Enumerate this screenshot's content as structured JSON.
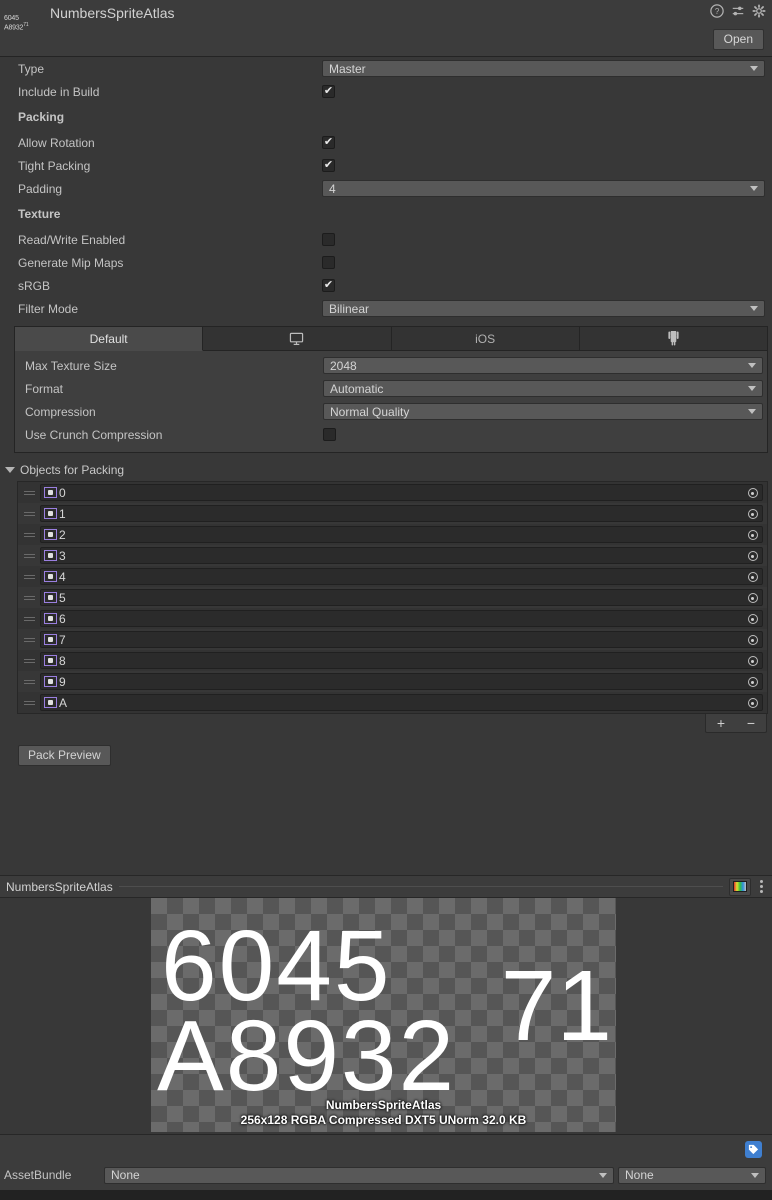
{
  "header": {
    "title": "NumbersSpriteAtlas",
    "thumb_line1": "6045",
    "thumb_line2": "A8932",
    "thumb_sup": "71",
    "open_label": "Open",
    "icons": [
      {
        "name": "help-icon",
        "glyph": "?"
      },
      {
        "name": "preset-icon",
        "glyph": ""
      },
      {
        "name": "gear-icon",
        "glyph": ""
      }
    ]
  },
  "properties": {
    "type": {
      "label": "Type",
      "value": "Master"
    },
    "include_in_build": {
      "label": "Include in Build",
      "checked": true
    }
  },
  "packing": {
    "section_label": "Packing",
    "allow_rotation": {
      "label": "Allow Rotation",
      "checked": true
    },
    "tight_packing": {
      "label": "Tight Packing",
      "checked": true
    },
    "padding": {
      "label": "Padding",
      "value": "4"
    }
  },
  "texture": {
    "section_label": "Texture",
    "read_write": {
      "label": "Read/Write Enabled",
      "checked": false
    },
    "mip_maps": {
      "label": "Generate Mip Maps",
      "checked": false
    },
    "srgb": {
      "label": "sRGB",
      "checked": true
    },
    "filter_mode": {
      "label": "Filter Mode",
      "value": "Bilinear"
    }
  },
  "platform_tabs": [
    {
      "label": "Default",
      "icon": "text",
      "active": true
    },
    {
      "label": "",
      "icon": "monitor-icon",
      "active": false
    },
    {
      "label": "iOS",
      "icon": "text",
      "active": false
    },
    {
      "label": "",
      "icon": "android-icon",
      "active": false
    }
  ],
  "platform_settings": {
    "max_texture_size": {
      "label": "Max Texture Size",
      "value": "2048"
    },
    "format": {
      "label": "Format",
      "value": "Automatic"
    },
    "compression": {
      "label": "Compression",
      "value": "Normal Quality"
    },
    "crunch": {
      "label": "Use Crunch Compression",
      "checked": false
    }
  },
  "objects_for_packing": {
    "foldout_label": "Objects for Packing",
    "items": [
      {
        "name": "0"
      },
      {
        "name": "1"
      },
      {
        "name": "2"
      },
      {
        "name": "3"
      },
      {
        "name": "4"
      },
      {
        "name": "5"
      },
      {
        "name": "6"
      },
      {
        "name": "7"
      },
      {
        "name": "8"
      },
      {
        "name": "9"
      },
      {
        "name": "A"
      }
    ],
    "add_label": "+",
    "remove_label": "−"
  },
  "pack_preview": {
    "label": "Pack Preview"
  },
  "preview": {
    "title": "NumbersSpriteAtlas",
    "atlas_row1": "6045",
    "atlas_row2": "A8932",
    "atlas_tail": "71",
    "info_name": "NumbersSpriteAtlas",
    "info_details": "256x128 RGBA Compressed DXT5 UNorm   32.0 KB"
  },
  "footer": {
    "assetbundle_label": "AssetBundle",
    "assetbundle_value": "None",
    "variant_value": "None"
  },
  "colors": {
    "window_bg": "#383838",
    "panel_bg": "#3c3c3c",
    "field_bg": "#585858",
    "list_bg": "#333333",
    "accent_blue": "#3f7fd0",
    "sprite_purple": "#9a7fe0"
  }
}
